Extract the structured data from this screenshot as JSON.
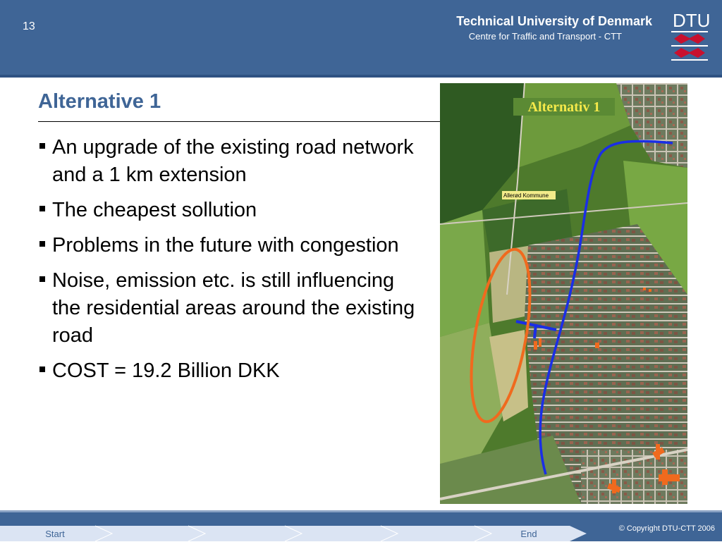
{
  "header": {
    "page_number": "13",
    "university": "Technical University of Denmark",
    "centre": "Centre for Traffic and Transport - CTT",
    "logo_text": "DTU",
    "background_color": "#3f6596"
  },
  "slide": {
    "title": "Alternative 1",
    "title_color": "#3f6596",
    "bullets": [
      "An upgrade of the existing road network and a 1 km extension",
      "The cheapest sollution",
      "Problems in the future with congestion",
      "Noise, emission etc. is still influencing the residential areas around the existing road",
      "COST = 19.2 Billion DKK"
    ]
  },
  "map": {
    "caption": "Alternativ 1",
    "place_label": "Allerød Kommune",
    "route_color": "#1a2ee6",
    "ellipse_color": "#f06a1e"
  },
  "footer": {
    "nav_start": "Start",
    "nav_end": "End",
    "copyright": "© Copyright DTU-CTT 2006"
  }
}
